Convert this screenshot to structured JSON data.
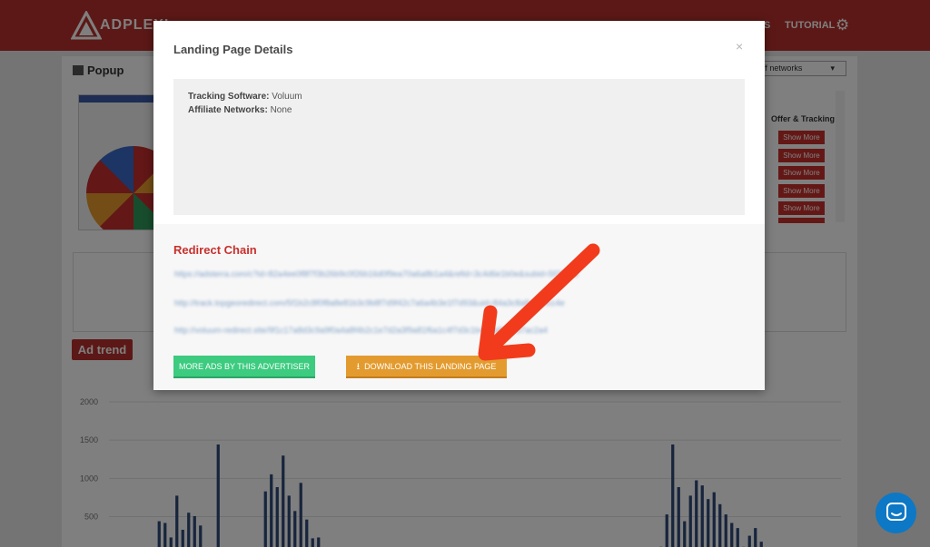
{
  "app": {
    "logo_text": "ADPLEXI",
    "nav": [
      {
        "label": "S"
      },
      {
        "label": "TUTORIAL"
      }
    ],
    "section_title": "Popup",
    "filter_value": "off networks",
    "offer_col_title": "Offer & Tracking",
    "show_more_label": "Show More",
    "ad_trend_label": "Ad trend"
  },
  "modal": {
    "title": "Landing Page Details",
    "close_symbol": "×",
    "details": {
      "tracking_label": "Tracking Software:",
      "tracking_value": "Voluum",
      "networks_label": "Affiliate Networks:",
      "networks_value": "None"
    },
    "redirect_title": "Redirect Chain",
    "redirect_urls": [
      "https://adsterra.com/c?id=82a4ee0f8f7f3b26b9c0f26b16d0f9ea70a6a8b1a4&refid=3c4d6e1b0e&subid=5f2b4ad",
      "http://track.topgeoredirect.com/5f1b2c8f0f8a8e81b3c9b8f7d9f42c7a6a4b3e1f7d93&uid=84a3c8a8ad10cc4e",
      "http://voluum-redirect.site/9f1c17a8d3c9a9f0a4a8f4b2c1e7d2a3f9a81f6a1c4f7d3c1b4e8a8e31d7ac2a4"
    ],
    "btn_more_ads": "MORE ADS BY THIS ADVERTISER",
    "btn_download": "DOWNLOAD THIS LANDING PAGE"
  },
  "chart_data": {
    "type": "bar",
    "yticks": [
      "2000",
      "1500",
      "1000",
      "500"
    ],
    "ylim": [
      0,
      2000
    ],
    "values": [
      0,
      0,
      0,
      0,
      0,
      30,
      40,
      100,
      600,
      580,
      410,
      900,
      500,
      700,
      660,
      550,
      0,
      80,
      1500,
      0,
      0,
      0,
      0,
      0,
      0,
      0,
      950,
      1150,
      1000,
      1370,
      900,
      720,
      1050,
      620,
      400,
      410,
      0,
      0,
      0,
      0,
      0,
      0,
      0,
      0,
      0,
      0,
      0,
      0,
      0,
      0,
      0,
      0,
      0,
      0,
      0,
      0,
      0,
      0,
      0,
      0,
      0,
      0,
      0,
      0,
      0,
      0,
      0,
      0,
      0,
      0,
      0,
      0,
      0,
      0,
      0,
      0,
      0,
      0,
      0,
      0,
      0,
      0,
      0,
      0,
      0,
      0,
      0,
      0,
      0,
      0,
      0,
      0,
      50,
      300,
      680,
      1500,
      1000,
      600,
      900,
      1080,
      1020,
      860,
      940,
      800,
      680,
      580,
      520,
      300,
      430,
      520,
      360,
      250,
      120,
      0,
      60,
      20,
      0,
      30,
      0,
      0,
      0,
      0,
      0,
      0
    ],
    "bar_color": "#2e4a7a"
  },
  "colors": {
    "brand_red": "#b8302c",
    "green": "#3ccb7f",
    "orange": "#e39b2f",
    "arrow": "#f23b1c",
    "chat": "#0d78c5"
  }
}
